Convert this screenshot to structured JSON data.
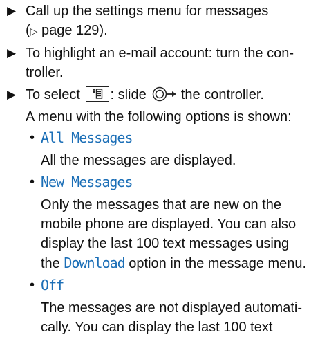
{
  "steps": [
    {
      "line1": "Call up the settings menu for messages",
      "line2_prefix": "(",
      "page_ref": "page 129",
      "line2_suffix": ")."
    },
    {
      "line1": "To highlight an e-mail account: turn the con-",
      "line2": "troller."
    },
    {
      "line1_before_key": "To select",
      "line1_after_key": ": slide",
      "line1_end": "the controller.",
      "line2": "A menu with the following options is shown:"
    }
  ],
  "options": [
    {
      "label": "All Messages",
      "desc": [
        "All the messages are displayed."
      ]
    },
    {
      "label": "New Messages",
      "desc": [
        "Only the messages that are new on the",
        "mobile phone are displayed. You can also",
        "display the last 100 text messages using"
      ],
      "desc_last": {
        "before": "the",
        "highlight": "Download",
        "after": "option in the message menu."
      }
    },
    {
      "label": "Off",
      "desc": [
        "The messages are not displayed automati-",
        "cally. You can display the last 100 text"
      ]
    }
  ],
  "colors": {
    "highlight": "#1c6fb7",
    "text": "#111111"
  },
  "icons": {
    "step_bullet": "right-triangle-arrow",
    "page_ref": "page-reference-triangle",
    "key": "menu-key-icon",
    "controller": "controller-slide-right-icon"
  }
}
